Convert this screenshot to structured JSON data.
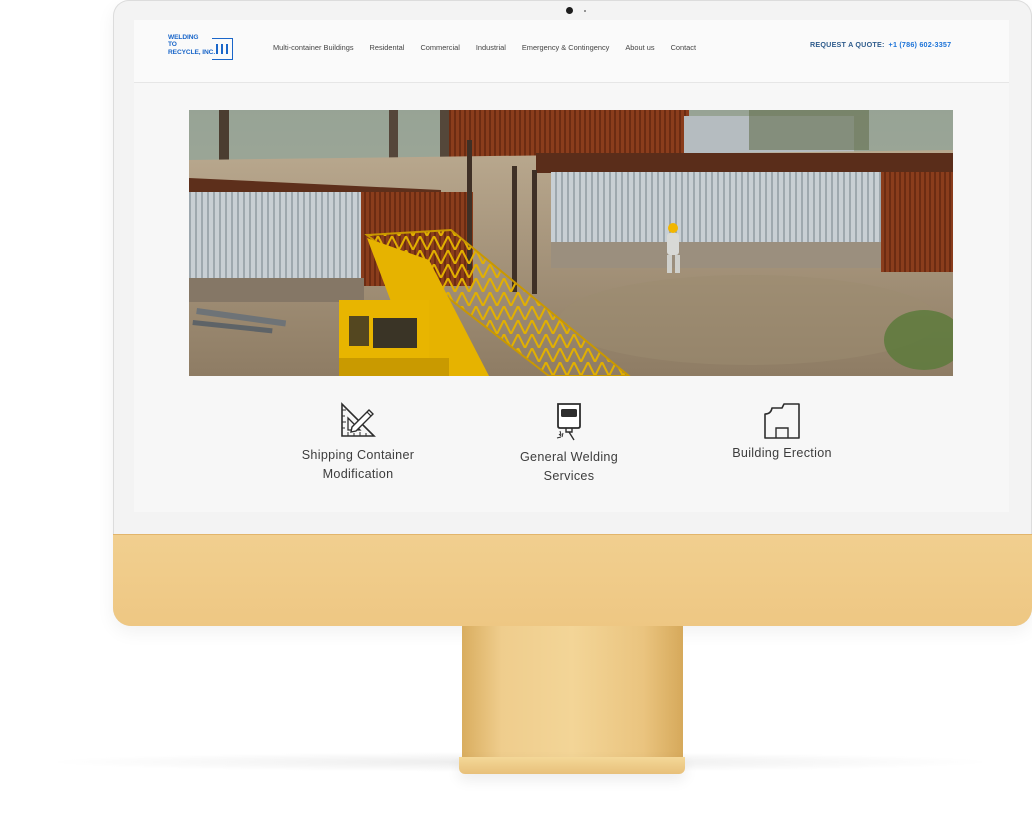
{
  "site": {
    "logo_lines": [
      "WELDING",
      "TO",
      "RECYCLE, INC."
    ],
    "brand_color": "#1a66c9"
  },
  "nav": {
    "items": [
      {
        "label": "Multi-container Buildings"
      },
      {
        "label": "Residental"
      },
      {
        "label": "Commercial"
      },
      {
        "label": "Industrial"
      },
      {
        "label": "Emergency & Contingency"
      },
      {
        "label": "About us"
      },
      {
        "label": "Contact"
      }
    ]
  },
  "quote": {
    "label": "REQUEST A QUOTE:",
    "phone": "+1 (786) 602-3357",
    "label_color": "#2f5c8c",
    "phone_color": "#1a72d8"
  },
  "hero": {
    "icon": "construction-site-photo"
  },
  "services": [
    {
      "icon": "ruler-pencil-icon",
      "title_lines": [
        "Shipping Container",
        "Modification"
      ]
    },
    {
      "icon": "welding-mask-icon",
      "title_lines": [
        "General Welding",
        "Services"
      ]
    },
    {
      "icon": "building-outline-icon",
      "title_lines": [
        "Building Erection"
      ]
    }
  ],
  "device": {
    "frame_color": "#f3f3f3",
    "chin_color": "#eec783"
  }
}
